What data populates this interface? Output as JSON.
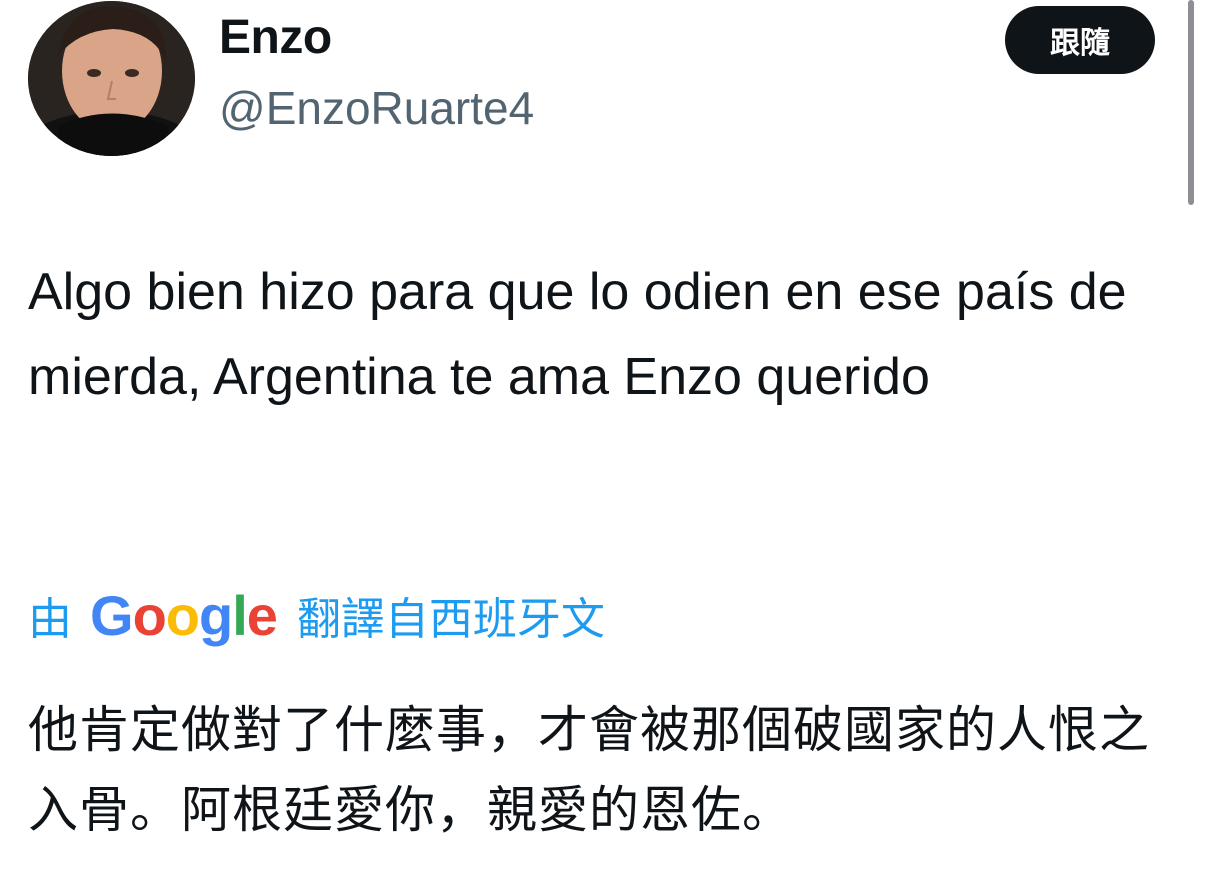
{
  "author": {
    "display_name": "Enzo",
    "handle": "@EnzoRuarte4"
  },
  "follow_button": {
    "label": "跟隨"
  },
  "tweet": {
    "text": "Algo bien hizo para que lo odien en ese país de mierda, Argentina te ama Enzo querido"
  },
  "translation": {
    "by_label": "由",
    "provider": "Google",
    "provider_letters": [
      {
        "char": "G",
        "color": "#4285F4"
      },
      {
        "char": "o",
        "color": "#EA4335"
      },
      {
        "char": "o",
        "color": "#FBBC05"
      },
      {
        "char": "g",
        "color": "#4285F4"
      },
      {
        "char": "l",
        "color": "#34A853"
      },
      {
        "char": "e",
        "color": "#EA4335"
      }
    ],
    "link_label": "翻譯自西班牙文",
    "translated_text": "他肯定做對了什麼事，才會被那個破國家的人恨之入骨。阿根廷愛你，親愛的恩佐。"
  },
  "colors": {
    "accent": "#1d9bf0",
    "text_primary": "#0f1419",
    "text_secondary": "#536471",
    "button_bg": "#0f1419"
  }
}
